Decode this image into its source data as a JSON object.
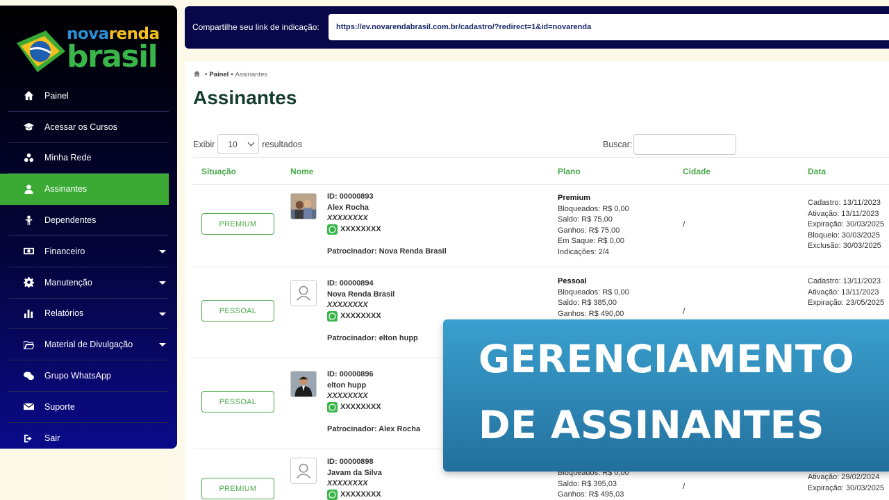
{
  "brand": {
    "line1_a": "nova",
    "line1_b": "renda",
    "line2": "brasil"
  },
  "sidebar": {
    "items": [
      {
        "label": "Painel",
        "icon": "home-icon"
      },
      {
        "label": "Acessar os Cursos",
        "icon": "graduation-cap-icon"
      },
      {
        "label": "Minha Rede",
        "icon": "network-icon"
      },
      {
        "label": "Assinantes",
        "icon": "user-icon",
        "active": true
      },
      {
        "label": "Dependentes",
        "icon": "child-icon"
      },
      {
        "label": "Financeiro",
        "icon": "money-icon",
        "submenu": true
      },
      {
        "label": "Manutenção",
        "icon": "gear-icon",
        "submenu": true
      },
      {
        "label": "Relatórios",
        "icon": "bar-chart-icon",
        "submenu": true
      },
      {
        "label": "Material de Divulgação",
        "icon": "folder-open-icon",
        "submenu": true
      },
      {
        "label": "Grupo WhatsApp",
        "icon": "chat-icon"
      },
      {
        "label": "Suporte",
        "icon": "envelope-icon"
      },
      {
        "label": "Sair",
        "icon": "sign-out-icon"
      }
    ]
  },
  "referral": {
    "label": "Compartilhe seu link de indicação:",
    "url": "https://ev.novarendabrasil.com.br/cadastro/?redirect=1&id=novarenda"
  },
  "breadcrumb": {
    "root": "Painel",
    "sep": "•",
    "current": "Assinantes"
  },
  "page": {
    "title": "Assinantes"
  },
  "controls": {
    "show_label": "Exibir",
    "entries_value": "10",
    "results_label": "resultados",
    "search_label": "Buscar:"
  },
  "table": {
    "headers": [
      "Situação",
      "Nome",
      "Plano",
      "Cidade",
      "Data"
    ],
    "rows": [
      {
        "status": "PREMIUM",
        "id": "ID: 00000893",
        "name": "Alex Rocha",
        "masked": "XXXXXXXX",
        "phone": "XXXXXXXX",
        "sponsor": "Patrocinador: Nova Renda Brasil",
        "plan": "Premium",
        "plan_lines": [
          "Bloqueados: R$ 0,00",
          "Saldo: R$ 75,00",
          "Ganhos: R$ 75,00",
          "Em Saque: R$ 0,00",
          "Indicações: 2/4"
        ],
        "city": "/",
        "dates": [
          "Cadastro: 13/11/2023",
          "Ativação: 13/11/2023",
          "Expiração: 30/03/2025",
          "Bloqueio: 30/03/2025",
          "Exclusão: 30/03/2025"
        ]
      },
      {
        "status": "PESSOAL",
        "id": "ID: 00000894",
        "name": "Nova Renda Brasil",
        "masked": "XXXXXXXX",
        "phone": "XXXXXXXX",
        "sponsor": "Patrocinador: elton hupp",
        "plan": "Pessoal",
        "plan_lines": [
          "Bloqueados: R$ 0,00",
          "Saldo: R$ 385,00",
          "Ganhos: R$ 490,00"
        ],
        "city": "/",
        "dates": [
          "Cadastro: 13/11/2023",
          "Ativação: 13/11/2023",
          "Expiração: 23/05/2025"
        ]
      },
      {
        "status": "PESSOAL",
        "id": "ID: 00000896",
        "name": "elton hupp",
        "masked": "XXXXXXXX",
        "phone": "XXXXXXXX",
        "sponsor": "Patrocinador: Alex Rocha"
      },
      {
        "status": "PREMIUM",
        "id": "ID: 00000898",
        "name": "Javam da Silva",
        "masked": "XXXXXXXX",
        "phone": "XXXXXXXX",
        "plan_lines": [
          "Bloqueados: R$ 0,00",
          "Saldo: R$ 395,03",
          "Ganhos: R$ 495,03"
        ],
        "city": "/",
        "dates": [
          "Ativação: 29/02/2024",
          "Expiração: 30/03/2025"
        ]
      }
    ]
  },
  "banner": {
    "line1": "GERENCIAMENTO",
    "line2": "DE ASSINANTES"
  },
  "colors": {
    "accent_green": "#3aaa35",
    "sidebar_bg": "#04043a",
    "banner_blue": "#2f8cbf",
    "title_green": "#153d2c"
  }
}
